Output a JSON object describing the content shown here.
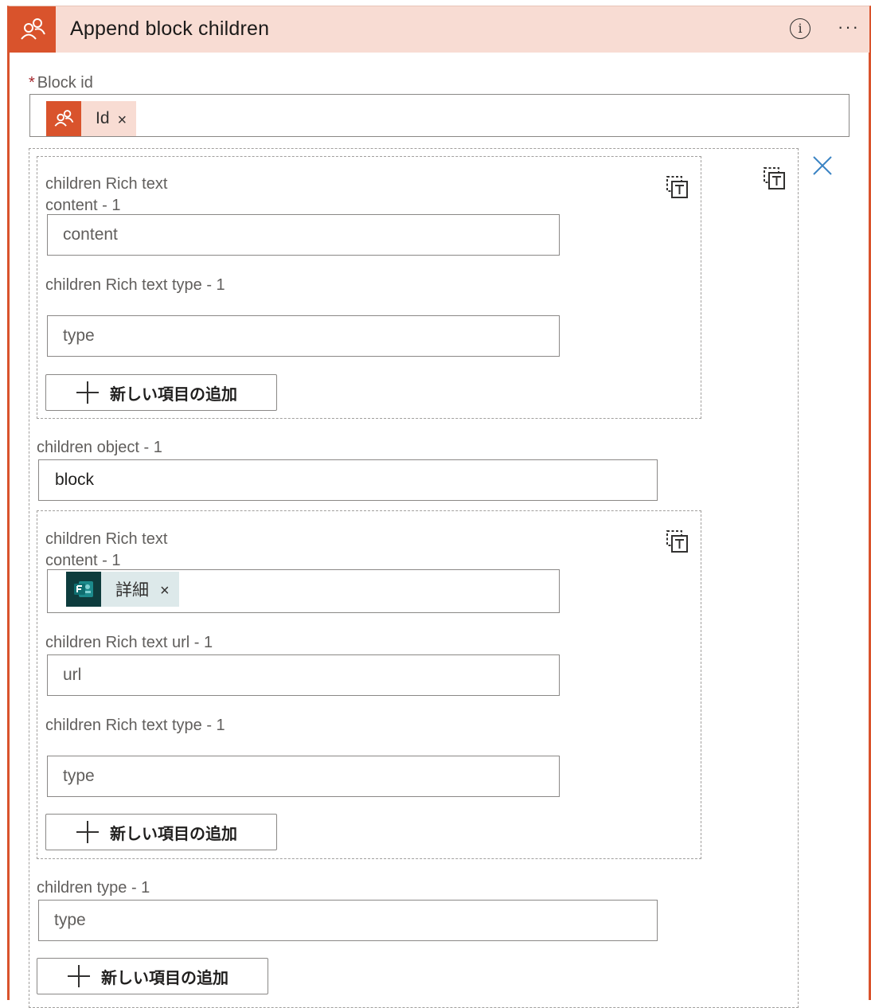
{
  "header": {
    "title": "Append block children",
    "info_label": "i",
    "more_label": "···",
    "accent": "#d9532c",
    "icon": "people-icon"
  },
  "block_id": {
    "required_mark": "*",
    "label": "Block id",
    "token": {
      "text": "Id",
      "remove": "×",
      "icon": "people-icon"
    }
  },
  "item": {
    "rich_text_1": {
      "content_label": "children Rich text content - 1",
      "content_placeholder": "content",
      "type_label": "children Rich text type - 1",
      "type_placeholder": "type",
      "add_label": "新しい項目の追加",
      "remove_icon": "delete-item-icon"
    },
    "object": {
      "label": "children object - 1",
      "value": "block"
    },
    "rich_text_2": {
      "content_label": "children Rich text content - 1",
      "content_token": {
        "text": "詳細",
        "remove": "×",
        "icon": "forms-icon"
      },
      "url_label": "children Rich text url - 1",
      "url_placeholder": "url",
      "type_label": "children Rich text type - 1",
      "type_placeholder": "type",
      "add_label": "新しい項目の追加",
      "remove_icon": "delete-item-icon"
    },
    "type": {
      "label": "children type - 1",
      "placeholder": "type"
    },
    "add_label": "新しい項目の追加",
    "remove_icon": "delete-item-icon"
  },
  "close_icon": "close-icon"
}
